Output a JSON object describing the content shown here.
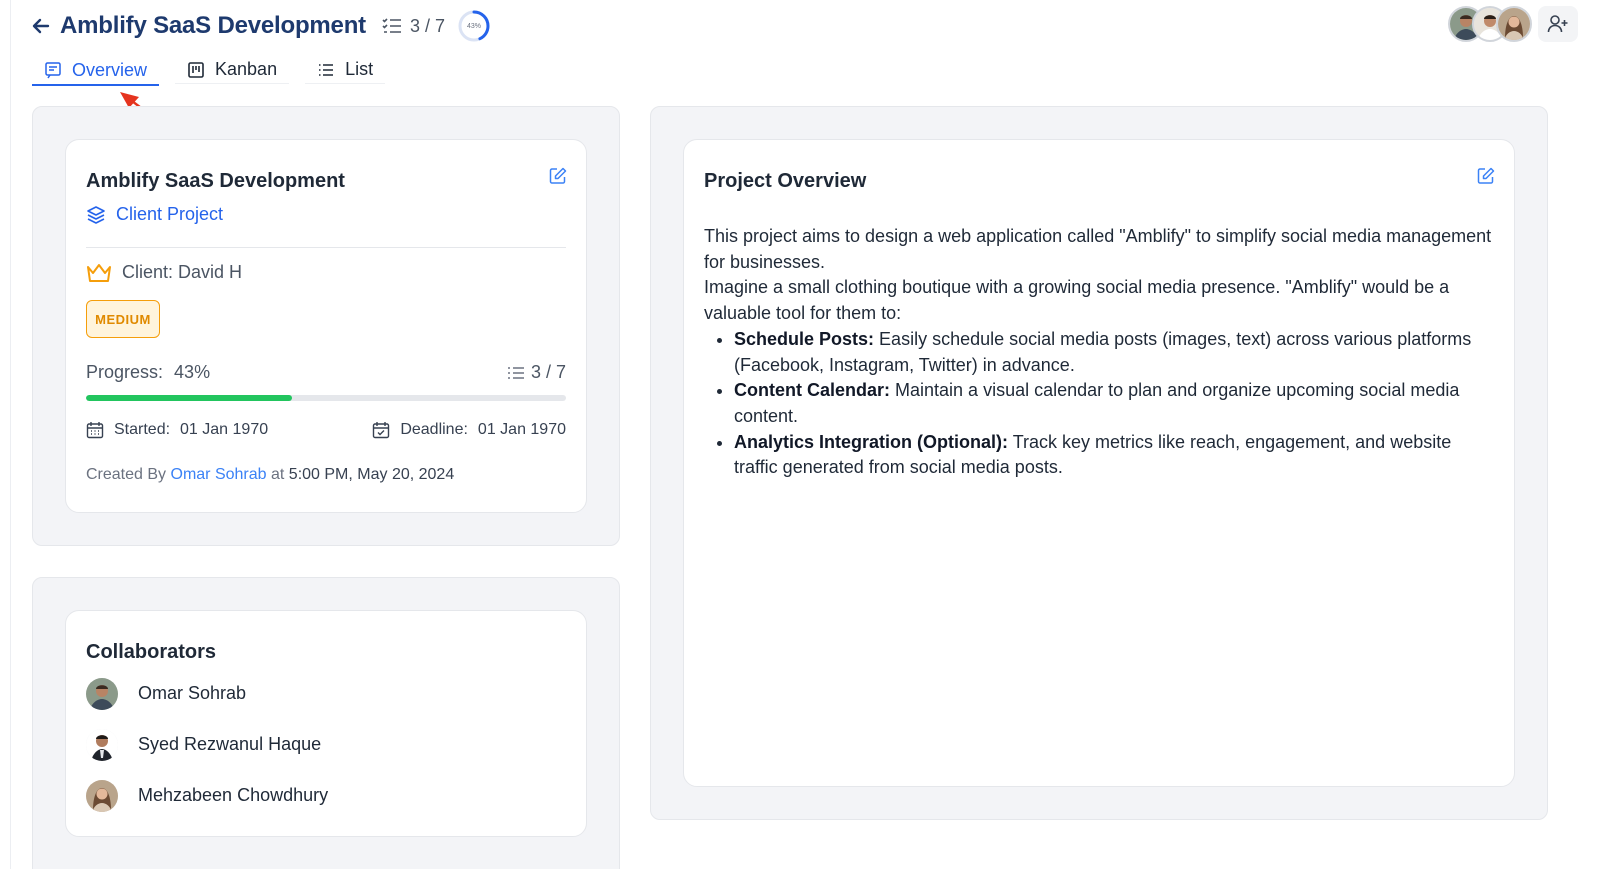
{
  "header": {
    "title": "Amblify SaaS Development",
    "task_count": "3 / 7",
    "progress_ring_label": "43%",
    "progress_fraction": 0.43
  },
  "tabs": [
    {
      "label": "Overview",
      "icon": "document-icon",
      "active": true
    },
    {
      "label": "Kanban",
      "icon": "kanban-icon",
      "active": false
    },
    {
      "label": "List",
      "icon": "list-icon",
      "active": false
    }
  ],
  "project_card": {
    "title": "Amblify SaaS Development",
    "type": "Client Project",
    "client": "Client: David H",
    "priority": "MEDIUM",
    "progress_label": "Progress:",
    "progress_value": "43%",
    "progress_fraction": 0.43,
    "tasks": "3 / 7",
    "started_label": "Started:",
    "started_value": "01 Jan 1970",
    "deadline_label": "Deadline:",
    "deadline_value": "01 Jan 1970",
    "created_prefix": "Created By",
    "created_by": "Omar Sohrab",
    "created_at_word": "at",
    "created_at": "5:00 PM, May 20, 2024"
  },
  "collaborators": {
    "title": "Collaborators",
    "people": [
      {
        "name": "Omar Sohrab"
      },
      {
        "name": "Syed Rezwanul Haque"
      },
      {
        "name": "Mehzabeen Chowdhury"
      }
    ]
  },
  "overview": {
    "title": "Project Overview",
    "p1": "This project aims to design a web application called \"Amblify\" to simplify social media management for businesses.",
    "p2": "Imagine a small clothing boutique with a growing social media presence. \"Amblify\" would be a valuable tool for them to:",
    "bullets": [
      {
        "bold": "Schedule Posts:",
        "text": " Easily schedule social media posts (images, text) across various platforms (Facebook, Instagram, Twitter) in advance."
      },
      {
        "bold": "Content Calendar:",
        "text": " Maintain a visual calendar to plan and organize upcoming social media content."
      },
      {
        "bold": "Analytics Integration (Optional):",
        "text": " Track key metrics like reach, engagement, and website traffic generated from social media posts."
      }
    ]
  },
  "colors": {
    "accent": "#2563eb",
    "title": "#1e3a6e",
    "progress": "#22c55e",
    "badge": "#f59e0b",
    "annotation_arrow": "#e5341f"
  }
}
